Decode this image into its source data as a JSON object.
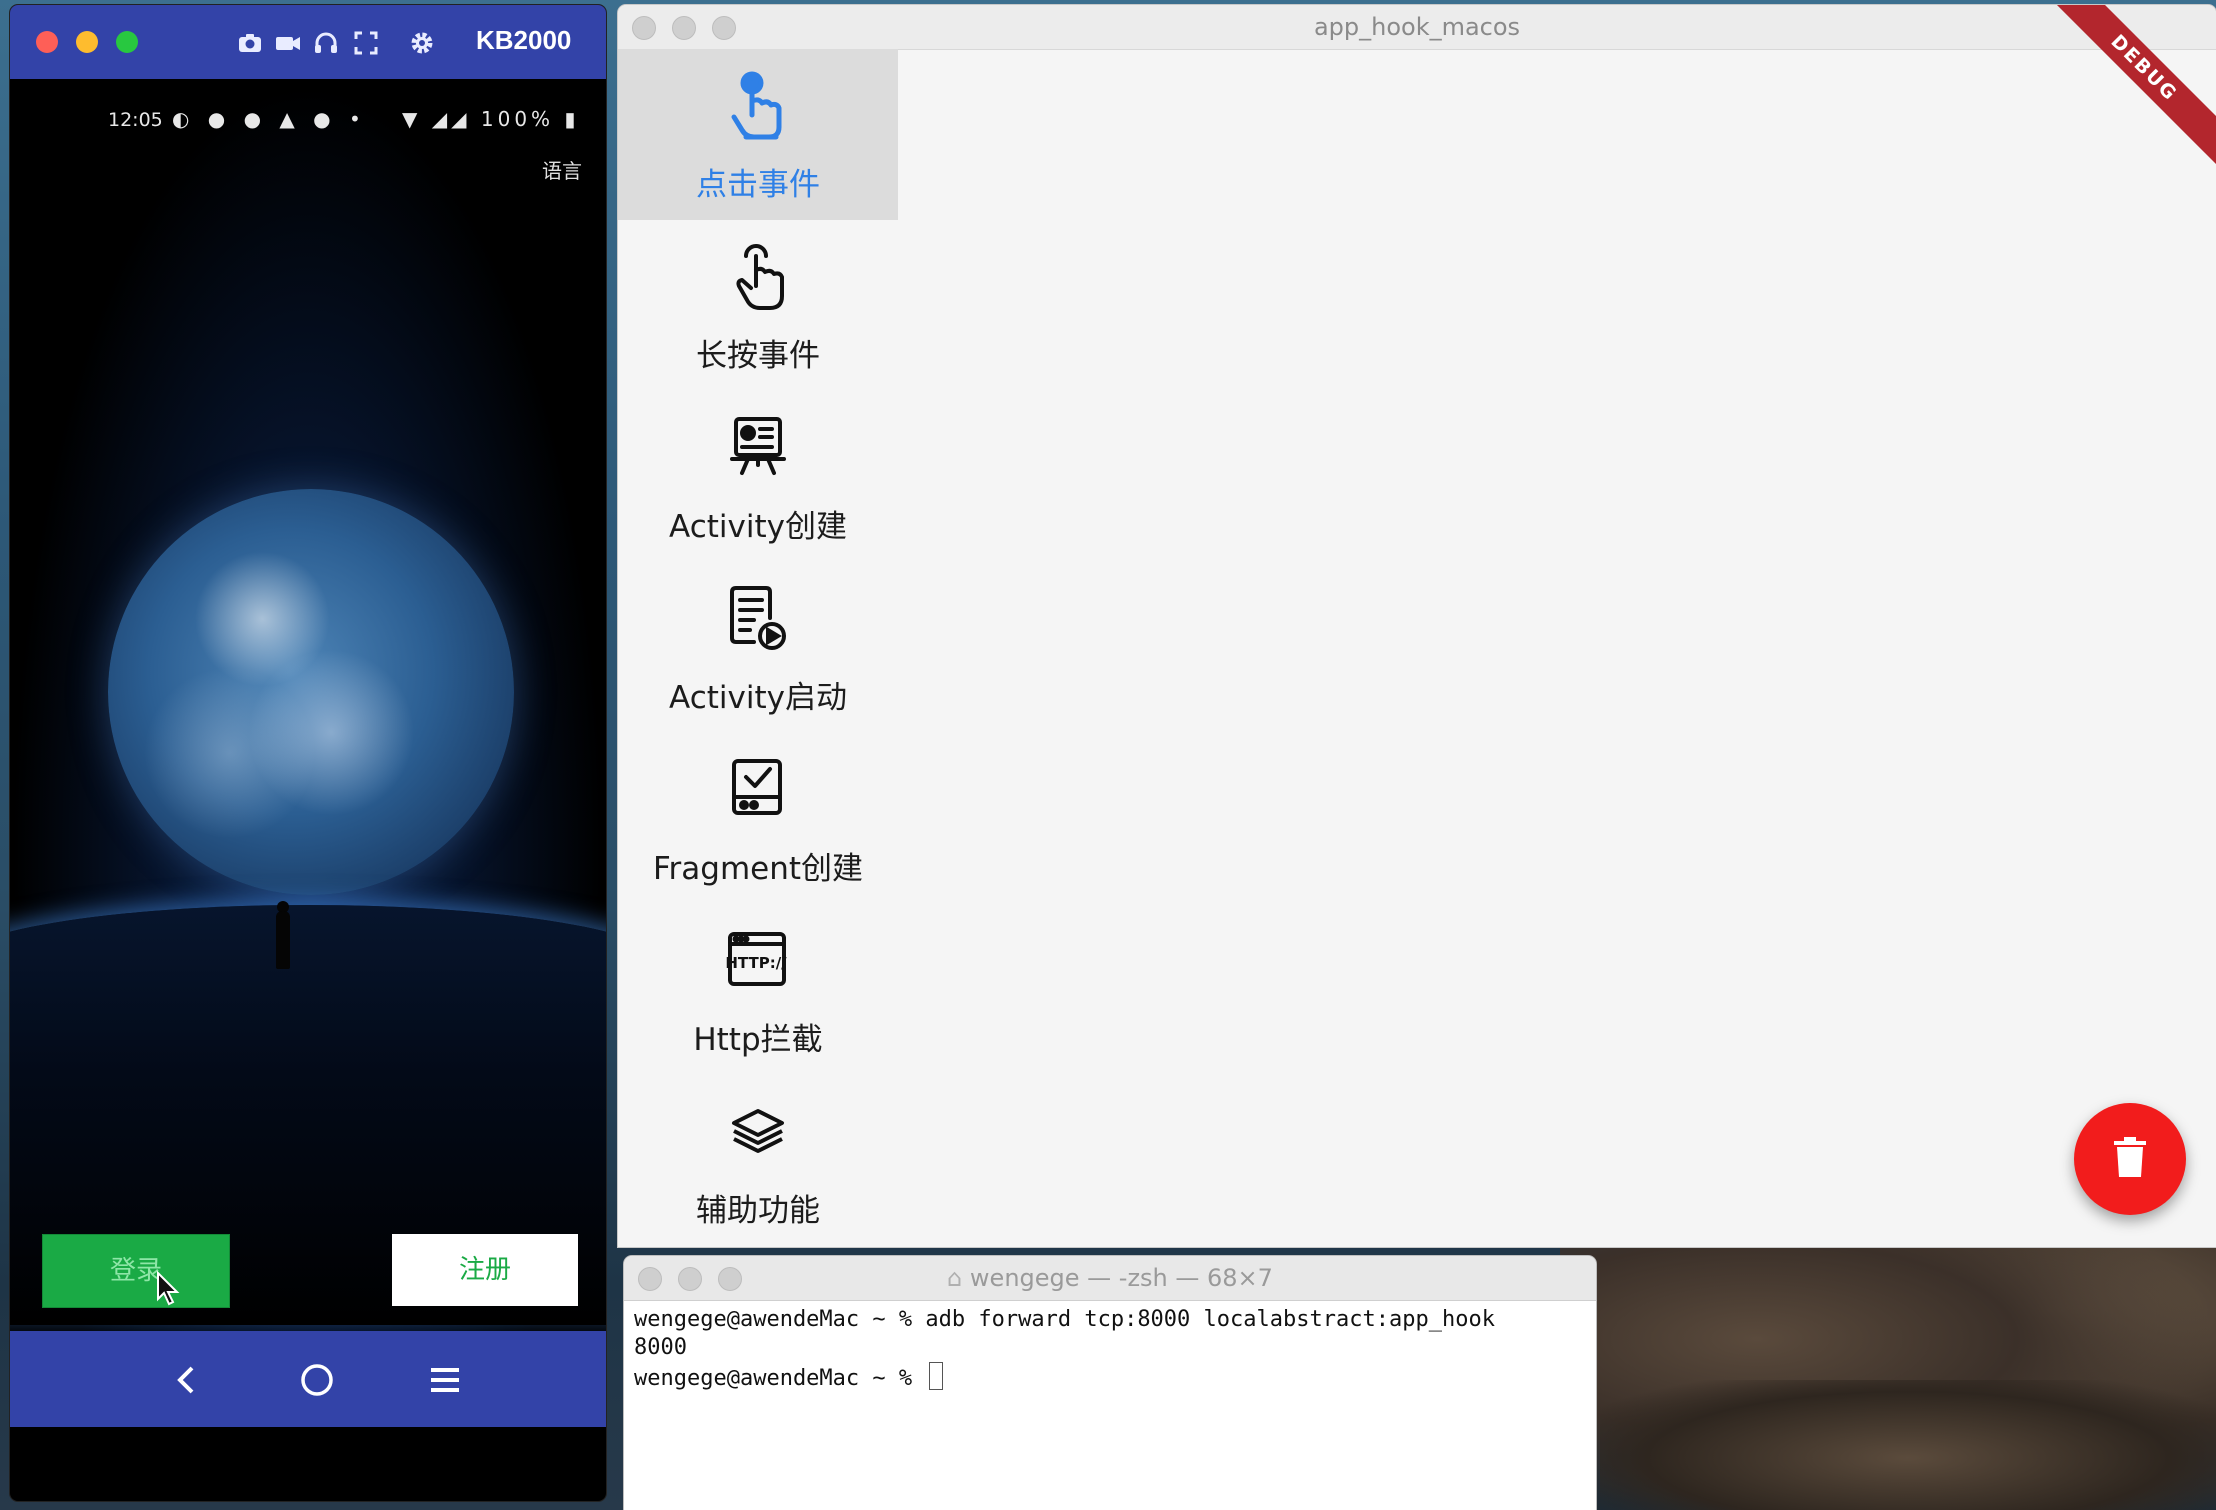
{
  "phone_window": {
    "device_name": "KB2000",
    "status": {
      "time": "12:05",
      "battery": "100%"
    },
    "language_label": "语言",
    "login_button": "登录",
    "register_button": "注册"
  },
  "app_window": {
    "title": "app_hook_macos",
    "debug_banner": "DEBUG",
    "nav_items": [
      {
        "label": "点击事件",
        "icon": "tap-icon",
        "selected": true
      },
      {
        "label": "长按事件",
        "icon": "long-press-icon",
        "selected": false
      },
      {
        "label": "Activity创建",
        "icon": "presentation-icon",
        "selected": false
      },
      {
        "label": "Activity启动",
        "icon": "document-play-icon",
        "selected": false
      },
      {
        "label": "Fragment创建",
        "icon": "checkbox-screen-icon",
        "selected": false
      },
      {
        "label": "Http拦截",
        "icon": "http-icon",
        "selected": false
      },
      {
        "label": "辅助功能",
        "icon": "layers-icon",
        "selected": false
      }
    ],
    "fab_icon": "trash-icon",
    "accent_color": "#2f80e6",
    "fab_color": "#f21c1c"
  },
  "terminal_window": {
    "title": "wengege — -zsh — 68×7",
    "lines": [
      "wengege@awendeMac ~ % adb forward tcp:8000 localabstract:app_hook",
      "8000",
      "wengege@awendeMac ~ % "
    ]
  }
}
